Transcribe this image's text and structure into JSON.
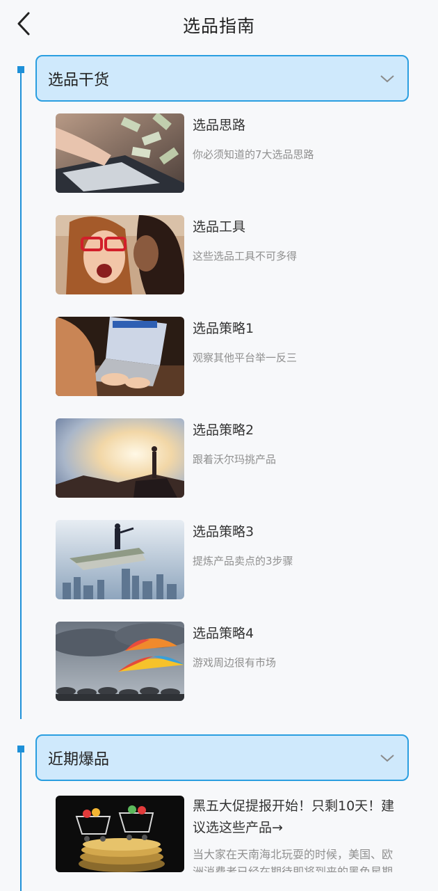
{
  "header": {
    "title": "选品指南"
  },
  "sections": [
    {
      "title": "选品干货",
      "items": [
        {
          "title": "选品思路",
          "subtitle": "你必须知道的7大选品思路"
        },
        {
          "title": "选品工具",
          "subtitle": "这些选品工具不可多得"
        },
        {
          "title": "选品策略1",
          "subtitle": "观察其他平台举一反三"
        },
        {
          "title": "选品策略2",
          "subtitle": "跟着沃尔玛挑产品"
        },
        {
          "title": "选品策略3",
          "subtitle": "提炼产品卖点的3步骤"
        },
        {
          "title": "选品策略4",
          "subtitle": "游戏周边很有市场"
        }
      ]
    },
    {
      "title": "近期爆品",
      "items": [
        {
          "title": "黑五大促提报开始！只剩10天！建议选这些产品→",
          "subtitle": "当大家在天南海北玩耍的时候，美国、欧洲消费者已经在期待即将到来的黑色星期五啦"
        }
      ]
    }
  ],
  "colors": {
    "accent": "#1e90d8",
    "section_bg": "#cfe9fc",
    "page_bg": "#f7f8fa"
  }
}
